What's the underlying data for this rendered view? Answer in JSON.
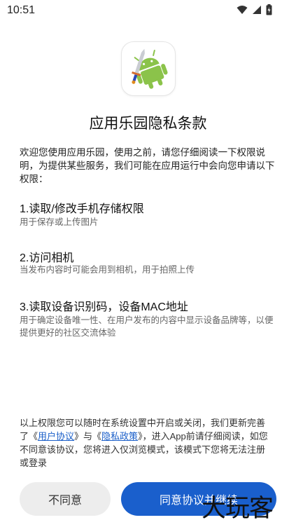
{
  "status_bar": {
    "time": "10:51",
    "icons": [
      "wifi-icon",
      "cellular-signal-icon",
      "battery-charging-icon"
    ]
  },
  "app": {
    "icon": "android-robot-with-sword-icon",
    "title": "应用乐园隐私条款"
  },
  "intro": "欢迎您使用应用乐园，使用之前，请您仔细阅读一下权限说明，为提供某些服务，我们可能在应用运行中会向您申请以下权限：",
  "permissions": [
    {
      "title": "1.读取/修改手机存储权限",
      "desc": "用于保存或上传图片"
    },
    {
      "title": "2.访问相机",
      "desc": "当发布内容时可能会用到相机，用于拍照上传"
    },
    {
      "title": "3.读取设备识别码，设备MAC地址",
      "desc": "用于确定设备唯一性、在用户发布的内容中显示设备品牌等，以便提供更好的社区交流体验"
    }
  ],
  "notice": {
    "part1": "以上权限您可以随时在系统设置中开启或关闭，我们更新完善了《",
    "user_agreement": "用户协议",
    "part2": "》与《",
    "privacy_policy": "隐私政策",
    "part3": "》，进入App前请仔细阅读，如您不同意该协议，您将进入仅浏览模式，该模式下您将无法注册或登录"
  },
  "buttons": {
    "decline": "不同意",
    "accept": "同意协议并继续"
  },
  "watermark": "大玩客",
  "colors": {
    "accent": "#1a5fcc",
    "link": "#1b5fc9",
    "android_green": "#8bc34a"
  }
}
